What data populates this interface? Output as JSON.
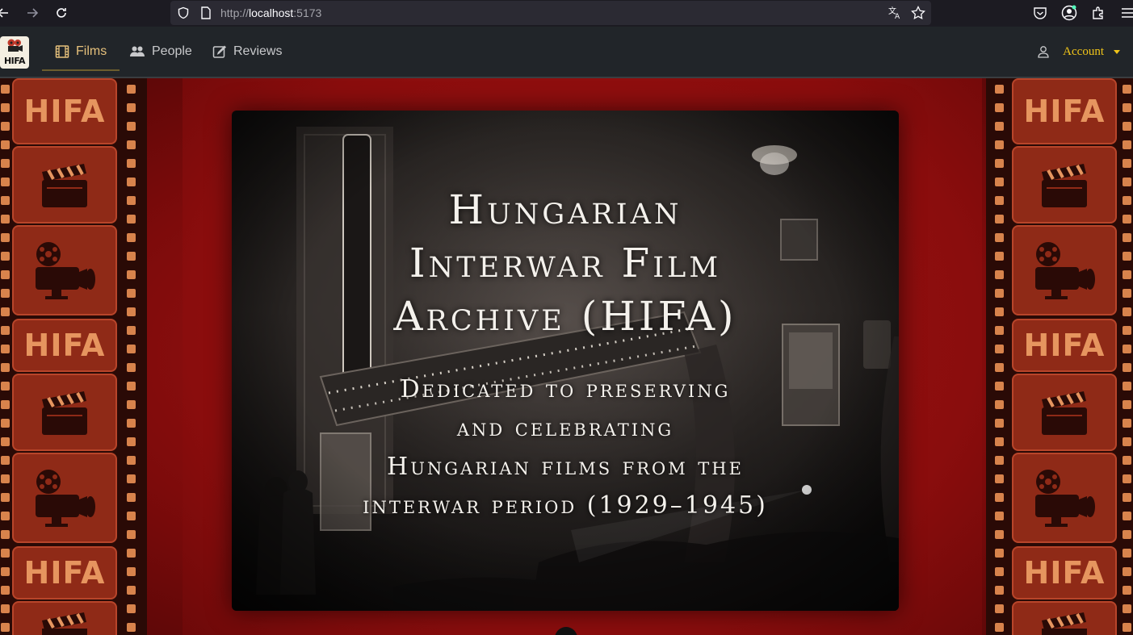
{
  "browser": {
    "url_prefix": "http://",
    "url_host": "localhost",
    "url_port": ":5173"
  },
  "app": {
    "logo_text": "HIFA",
    "nav": [
      {
        "label": "Films",
        "icon": "film-icon",
        "active": true
      },
      {
        "label": "People",
        "icon": "people-icon",
        "active": false
      },
      {
        "label": "Reviews",
        "icon": "edit-icon",
        "active": false
      }
    ],
    "account_label": "Account",
    "accent_color": "#e5c07b",
    "account_color": "#f0c419"
  },
  "hero": {
    "title_lines": [
      "Hungarian",
      "Interwar Film",
      "Archive (HIFA)"
    ],
    "subtitle_lines": [
      "Dedicated to preserving",
      "and celebrating",
      "Hungarian films from the",
      "interwar period (1929–1945)"
    ]
  },
  "filmstrip": {
    "frame_text": "HIFA",
    "frame_icons": [
      "clapperboard-icon",
      "film-camera-icon"
    ]
  }
}
